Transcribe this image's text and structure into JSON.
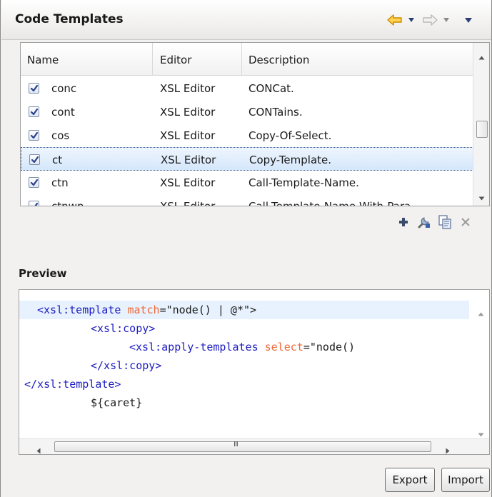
{
  "title": "Code Templates",
  "table": {
    "columns": [
      "Name",
      "Editor",
      "Description"
    ],
    "rows": [
      {
        "name": "conc",
        "editor": "XSL Editor",
        "description": "CONCat.",
        "checked": true
      },
      {
        "name": "cont",
        "editor": "XSL Editor",
        "description": "CONTains.",
        "checked": true
      },
      {
        "name": "cos",
        "editor": "XSL Editor",
        "description": "Copy-Of-Select.",
        "checked": true
      },
      {
        "name": "ct",
        "editor": "XSL Editor",
        "description": "Copy-Template.",
        "checked": true,
        "selected": true
      },
      {
        "name": "ctn",
        "editor": "XSL Editor",
        "description": "Call-Template-Name.",
        "checked": true
      },
      {
        "name": "ctnwp",
        "editor": "XSL Editor",
        "description": "Call-Template-Name-With-Para...",
        "checked": true
      }
    ]
  },
  "toolbar": {
    "icons": [
      "add-icon",
      "edit-icon",
      "duplicate-icon",
      "remove-icon"
    ]
  },
  "preview": {
    "label": "Preview",
    "lines": [
      {
        "tag_open": "<xsl:template ",
        "attr": "match",
        "value": "=\"node() | @*\">",
        "tag_close": ""
      },
      {
        "tag_open": "<xsl:copy>",
        "attr": "",
        "value": "",
        "tag_close": ""
      },
      {
        "tag_open": "<xsl:apply-templates ",
        "attr": "select",
        "value": "=\"node()",
        "tag_close": ""
      },
      {
        "tag_open": "</xsl:copy>",
        "attr": "",
        "value": "",
        "tag_close": ""
      },
      {
        "tag_open": "</xsl:template>",
        "attr": "",
        "value": "",
        "tag_close": ""
      },
      {
        "tag_open": "",
        "attr": "",
        "value": "${caret}",
        "tag_close": ""
      }
    ],
    "scroll_marker": "III"
  },
  "buttons": {
    "export": "Export",
    "import": "Import"
  },
  "colors": {
    "tag": "#1c1cc0",
    "attribute": "#ee6a36",
    "selection": "#d5e7fb",
    "back_arrow": "#e8a800"
  }
}
